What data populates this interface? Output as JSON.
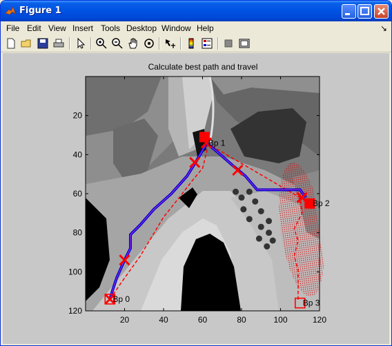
{
  "window": {
    "title": "Figure 1"
  },
  "menu": [
    "File",
    "Edit",
    "View",
    "Insert",
    "Tools",
    "Desktop",
    "Window",
    "Help"
  ],
  "menu_pin_glyph": "↘",
  "toolbar": [
    "new-figure-icon",
    "open-file-icon",
    "save-icon",
    "print-icon",
    "arrow-select-icon",
    "zoom-in-icon",
    "zoom-out-icon",
    "pan-hand-icon",
    "rotate-3d-icon",
    "data-cursor-icon",
    "colorbar-icon",
    "legend-icon",
    "hide-tools-icon",
    "show-tools-icon"
  ],
  "chart_data": {
    "type": "heatmap",
    "title": "Calculate best path and travel",
    "xlim": [
      0,
      120
    ],
    "ylim": [
      0,
      120
    ],
    "y_reversed": true,
    "xticks": [
      20,
      40,
      60,
      80,
      100,
      120
    ],
    "yticks": [
      20,
      40,
      60,
      80,
      100,
      120
    ],
    "colors": {
      "path": "#0000cc",
      "path_inner": "#8a2be2",
      "marker": "#ff0000",
      "dashed": "#ff0000",
      "dotted": "#dd0000"
    },
    "waypoints": [
      {
        "label": "Bp 0",
        "x": 12.5,
        "y": 114
      },
      {
        "label": "Bp 1",
        "x": 61.5,
        "y": 34
      },
      {
        "label": "Bp 2",
        "x": 115,
        "y": 65
      },
      {
        "label": "Bp 3",
        "x": 110,
        "y": 116
      }
    ],
    "best_path": [
      [
        12.5,
        114
      ],
      [
        14,
        109
      ],
      [
        16,
        103
      ],
      [
        20,
        94
      ],
      [
        23,
        88
      ],
      [
        23,
        81
      ],
      [
        28,
        76
      ],
      [
        35,
        68
      ],
      [
        44,
        60
      ],
      [
        52,
        51
      ],
      [
        57,
        43
      ],
      [
        61,
        36
      ],
      [
        62,
        34
      ],
      [
        68,
        39
      ],
      [
        76,
        46
      ],
      [
        82,
        51
      ],
      [
        88,
        58
      ],
      [
        110,
        58
      ],
      [
        113,
        62
      ]
    ],
    "travel_path_dashed": [
      [
        12.5,
        114
      ],
      [
        18,
        106
      ],
      [
        28,
        92
      ],
      [
        34,
        82
      ],
      [
        40,
        72
      ],
      [
        48,
        62
      ],
      [
        55,
        53
      ],
      [
        60,
        47
      ],
      [
        62.5,
        37
      ],
      [
        62,
        34
      ],
      [
        110,
        62
      ],
      [
        111,
        70
      ],
      [
        107,
        78
      ],
      [
        109,
        84
      ],
      [
        107,
        92
      ],
      [
        109,
        99
      ],
      [
        109,
        115
      ]
    ],
    "cross_markers": [
      [
        12.5,
        114
      ],
      [
        20,
        94
      ],
      [
        56,
        44
      ],
      [
        62,
        34
      ],
      [
        78,
        48
      ],
      [
        111,
        62
      ]
    ],
    "square_markers_filled": [
      [
        61,
        31
      ],
      [
        115,
        65
      ]
    ],
    "square_markers_open": [
      [
        12.5,
        114
      ],
      [
        110,
        116
      ]
    ],
    "dark_dots": [
      [
        77,
        59
      ],
      [
        80,
        62
      ],
      [
        84,
        59
      ],
      [
        87,
        64
      ],
      [
        81,
        68
      ],
      [
        90,
        69
      ],
      [
        84,
        73
      ],
      [
        94,
        74
      ],
      [
        90,
        77
      ],
      [
        94,
        80
      ],
      [
        89,
        83
      ],
      [
        96,
        84
      ],
      [
        93,
        87
      ]
    ]
  }
}
